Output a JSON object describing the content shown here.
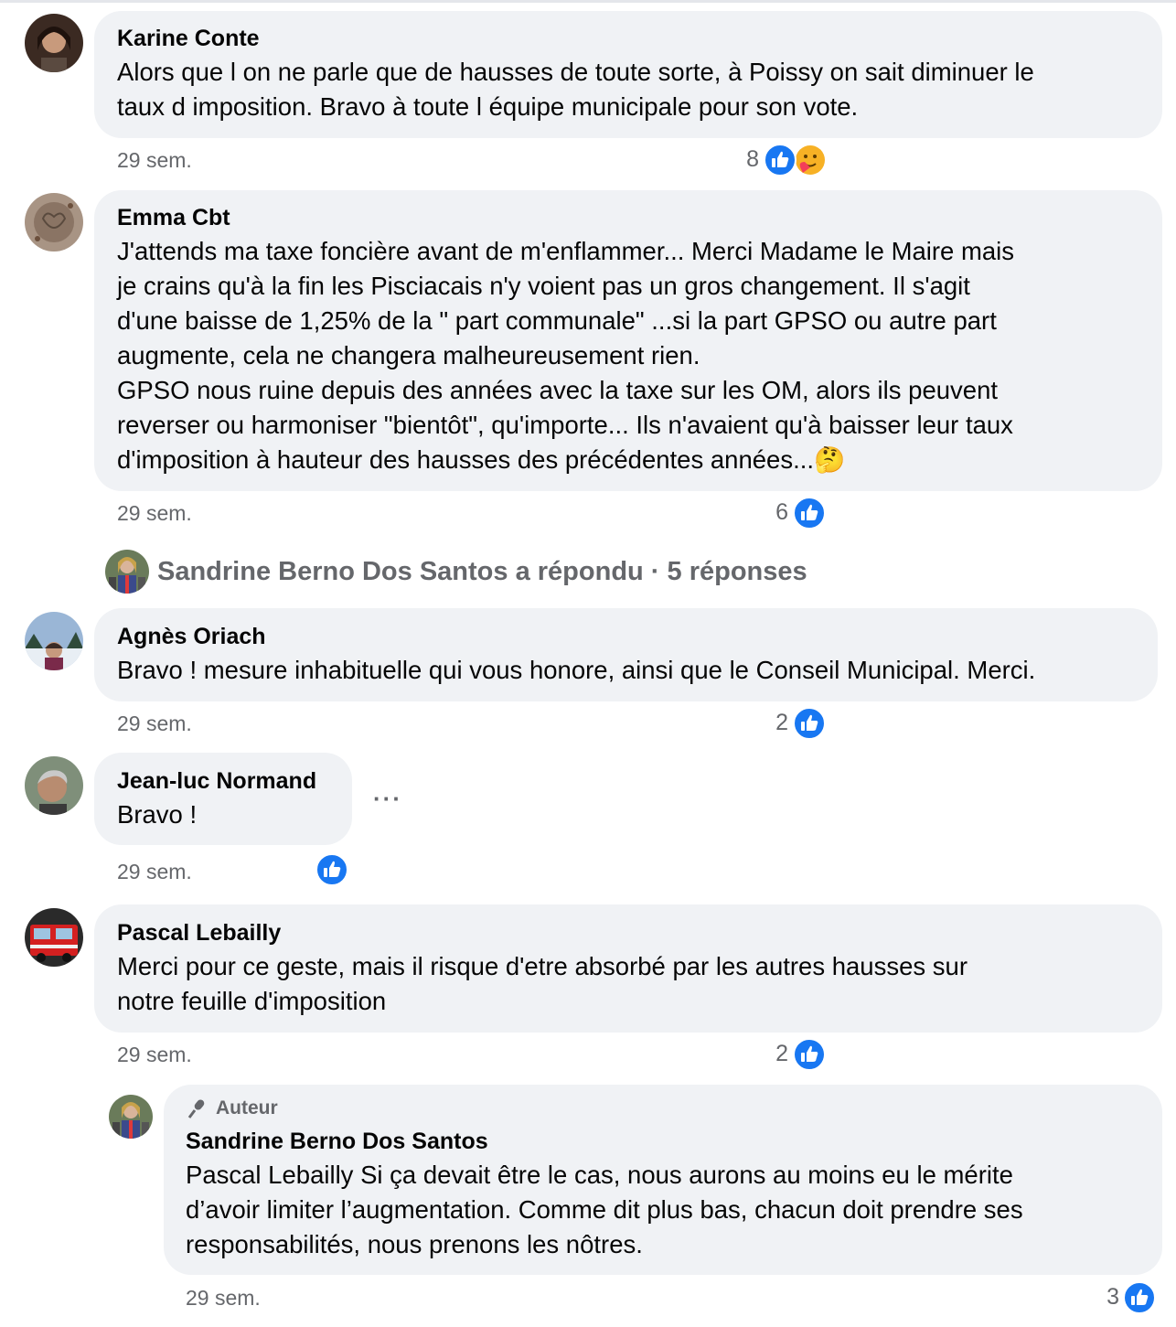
{
  "comments": [
    {
      "author": "Karine Conte",
      "text": "Alors que l on ne parle que de hausses de toute sorte, à Poissy on sait diminuer le\ntaux d imposition. Bravo à toute l équipe municipale pour son vote.",
      "time": "29 sem.",
      "reactions": "8"
    },
    {
      "author": "Emma Cbt",
      "text": "J'attends ma taxe foncière avant de m'enflammer... Merci Madame le Maire mais\nje crains qu'à la fin les Pisciacais n'y voient pas un gros changement. Il s'agit\nd'une baisse de 1,25% de la \" part communale\" ...si la part GPSO ou autre part\naugmente, cela ne changera malheureusement rien.\nGPSO nous ruine depuis des années avec la taxe sur les OM, alors ils peuvent\nreverser ou harmoniser \"bientôt\", qu'importe... Ils n'avaient qu'à baisser leur taux\nd'imposition à hauteur des hausses des précédentes années...🤔",
      "time": "29 sem.",
      "reactions": "6"
    },
    {
      "author": "Agnès Oriach",
      "text": "Bravo ! mesure inhabituelle qui vous honore, ainsi que le Conseil Municipal. Merci.",
      "time": "29 sem.",
      "reactions": "2"
    },
    {
      "author": "Jean-luc Normand",
      "text": "Bravo !",
      "time": "29 sem.",
      "reactions": ""
    },
    {
      "author": "Pascal Lebailly",
      "text": "Merci pour ce geste, mais il risque d'etre absorbé par les autres hausses sur\nnotre feuille d'imposition",
      "time": "29 sem.",
      "reactions": "2"
    }
  ],
  "replies_summary": "Sandrine Berno Dos Santos a répondu · 5 réponses",
  "reply": {
    "badge": "Auteur",
    "author": "Sandrine Berno Dos Santos",
    "text": "Pascal Lebailly Si ça devait être le cas, nous aurons au moins eu le mérite\nd’avoir limiter l’augmentation. Comme dit plus bas, chacun doit prendre ses\nresponsabilités, nous prenons les nôtres.",
    "time": "29 sem.",
    "reactions": "3"
  },
  "colors": {
    "bubble": "#f0f2f5",
    "like_blue": "#1877f2",
    "meta_gray": "#65676b"
  },
  "icons": [
    "like-icon",
    "care-icon",
    "more-icon",
    "microphone-icon"
  ]
}
